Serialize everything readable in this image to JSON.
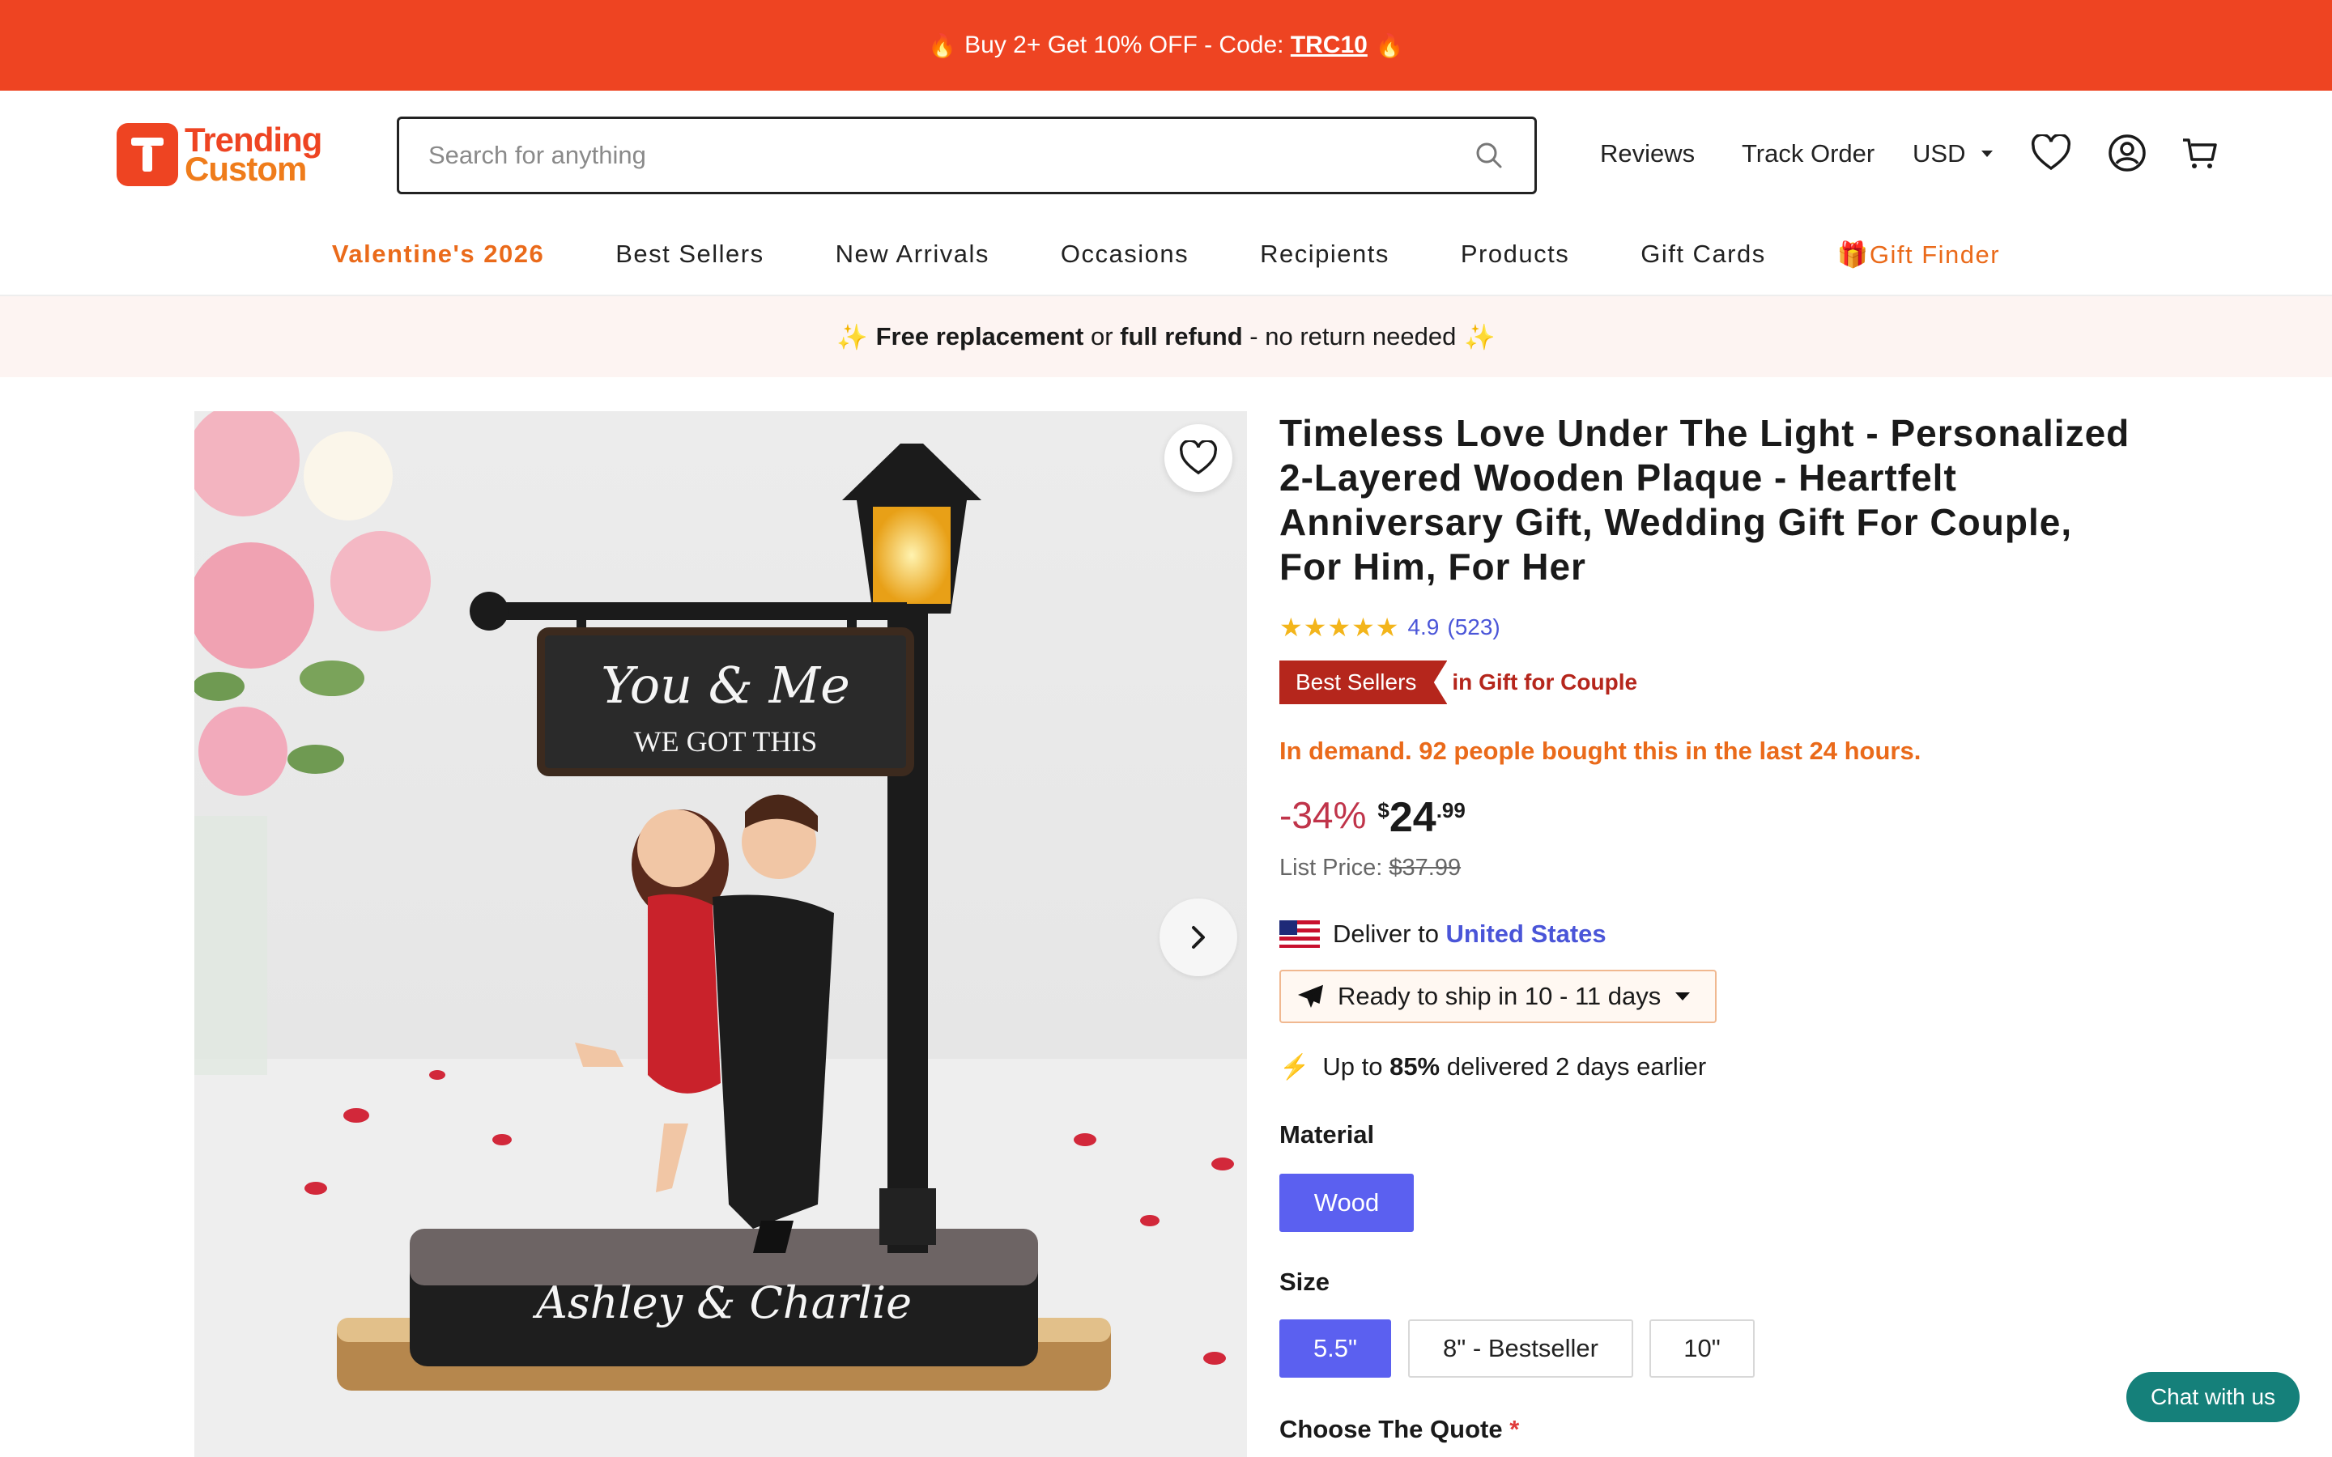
{
  "promo": {
    "text": "Buy 2+ Get 10% OFF - Code: ",
    "code": "TRC10"
  },
  "logo": {
    "line1": "Trending",
    "line2": "Custom"
  },
  "search": {
    "placeholder": "Search for anything"
  },
  "header_nav": {
    "reviews": "Reviews",
    "track_order": "Track Order",
    "currency": "USD"
  },
  "categories": [
    "Valentine's 2026",
    "Best Sellers",
    "New Arrivals",
    "Occasions",
    "Recipients",
    "Products",
    "Gift Cards",
    "Gift Finder"
  ],
  "assurance": {
    "part1": "Free replacement",
    "part2": " or ",
    "part3": "full refund",
    "part4": " - no return needed"
  },
  "gallery": {
    "sign_line1": "You & Me",
    "sign_line2": "WE GOT THIS",
    "base_text": "Ashley & Charlie"
  },
  "product": {
    "title": "Timeless Love Under The Light - Personalized 2-Layered Wooden Plaque - Heartfelt Anniversary Gift, Wedding Gift For Couple, For Him, For Her",
    "rating": "4.9",
    "reviews": "(523)",
    "rating_value": 4.9,
    "badge": "Best Sellers",
    "badge_category": "in Gift for Couple",
    "demand": "In demand. 92 people bought this in the last 24 hours.",
    "discount": "-34%",
    "currency_symbol": "$",
    "price_int": "24",
    "price_cents": ".99",
    "list_price_label": "List Price: ",
    "list_price": "$37.99",
    "deliver_label": "Deliver to ",
    "deliver_country": "United States",
    "ship_text": "Ready to ship in 10 - 11 days",
    "fast_pre": "Up to ",
    "fast_pct": "85%",
    "fast_post": " delivered 2 days earlier",
    "material_label": "Material",
    "materials": [
      "Wood"
    ],
    "size_label": "Size",
    "sizes": [
      "5.5\"",
      "8\" - Bestseller",
      "10\""
    ],
    "quote_label": "Choose The Quote",
    "required_mark": "*"
  },
  "chat": {
    "label": "Chat with us"
  },
  "colors": {
    "promo_bg": "#ee4422",
    "accent_orange": "#ea6a1a",
    "select_blue": "#5b60f0",
    "badge_red": "#b5261c",
    "chat_teal": "#15807a"
  },
  "icons": [
    "fire-icon",
    "search-icon",
    "chevron-down-icon",
    "heart-icon",
    "user-icon",
    "cart-icon",
    "gift-icon",
    "sparkle-icon",
    "star-icon",
    "plane-icon",
    "bolt-icon",
    "chevron-right-icon",
    "us-flag-icon"
  ]
}
